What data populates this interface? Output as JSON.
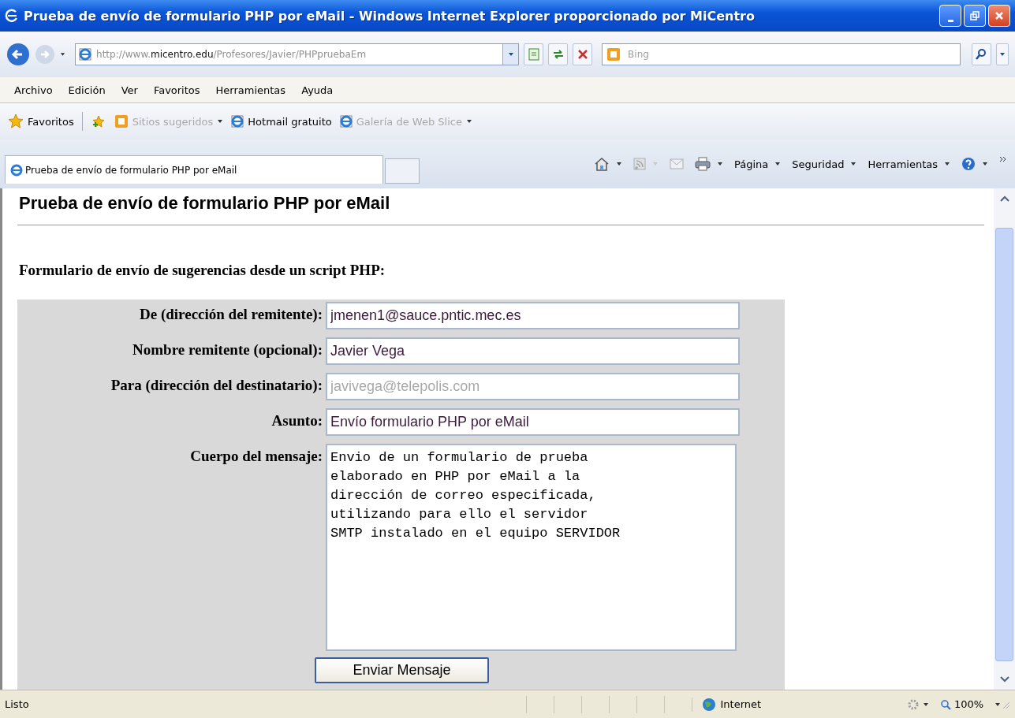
{
  "window": {
    "title": "Prueba de envío de formulario PHP por eMail - Windows Internet Explorer proporcionado por MiCentro"
  },
  "address_bar": {
    "url_host_prefix": "http://www.",
    "url_host": "micentro.edu",
    "url_path": "/Profesores/Javier/PHPpruebaEm"
  },
  "search": {
    "placeholder": "Bing"
  },
  "menu": [
    {
      "label": "Archivo"
    },
    {
      "label": "Edición"
    },
    {
      "label": "Ver"
    },
    {
      "label": "Favoritos"
    },
    {
      "label": "Herramientas"
    },
    {
      "label": "Ayuda"
    }
  ],
  "favorites_bar": {
    "favorites": "Favoritos",
    "links": [
      {
        "label": "Sitios sugeridos",
        "disabled": true,
        "dropdown": true
      },
      {
        "label": "Hotmail gratuito",
        "disabled": false,
        "dropdown": false
      },
      {
        "label": "Galería de Web Slice",
        "disabled": true,
        "dropdown": true
      }
    ]
  },
  "tabs": [
    {
      "label": "Prueba de envío de formulario PHP por eMail",
      "selected": true
    }
  ],
  "command_bar": [
    {
      "label": "Página"
    },
    {
      "label": "Seguridad"
    },
    {
      "label": "Herramientas"
    }
  ],
  "page": {
    "heading": "Prueba de envío de formulario PHP por eMail",
    "subheading": "Formulario de envío de sugerencias desde un script PHP:",
    "fields": [
      {
        "kind": "input",
        "label": "De (dirección del remitente):",
        "value": "jmenen1@sauce.pntic.mec.es"
      },
      {
        "kind": "input",
        "label": "Nombre remitente (opcional):",
        "value": "Javier Vega"
      },
      {
        "kind": "input",
        "label": "Para (dirección del destinatario):",
        "placeholder": "javivega@telepolis.com"
      },
      {
        "kind": "input",
        "label": "Asunto:",
        "value": "Envío formulario PHP por eMail"
      },
      {
        "kind": "textarea",
        "label": "Cuerpo del mensaje:",
        "value": "Envio de un formulario de prueba\nelaborado en PHP por eMail a la\ndirección de correo especificada,\nutilizando para ello el servidor\nSMTP instalado en el equipo SERVIDOR"
      }
    ],
    "submit": "Enviar Mensaje"
  },
  "status_bar": {
    "text": "Listo",
    "zone": "Internet",
    "zoom": "100%"
  }
}
